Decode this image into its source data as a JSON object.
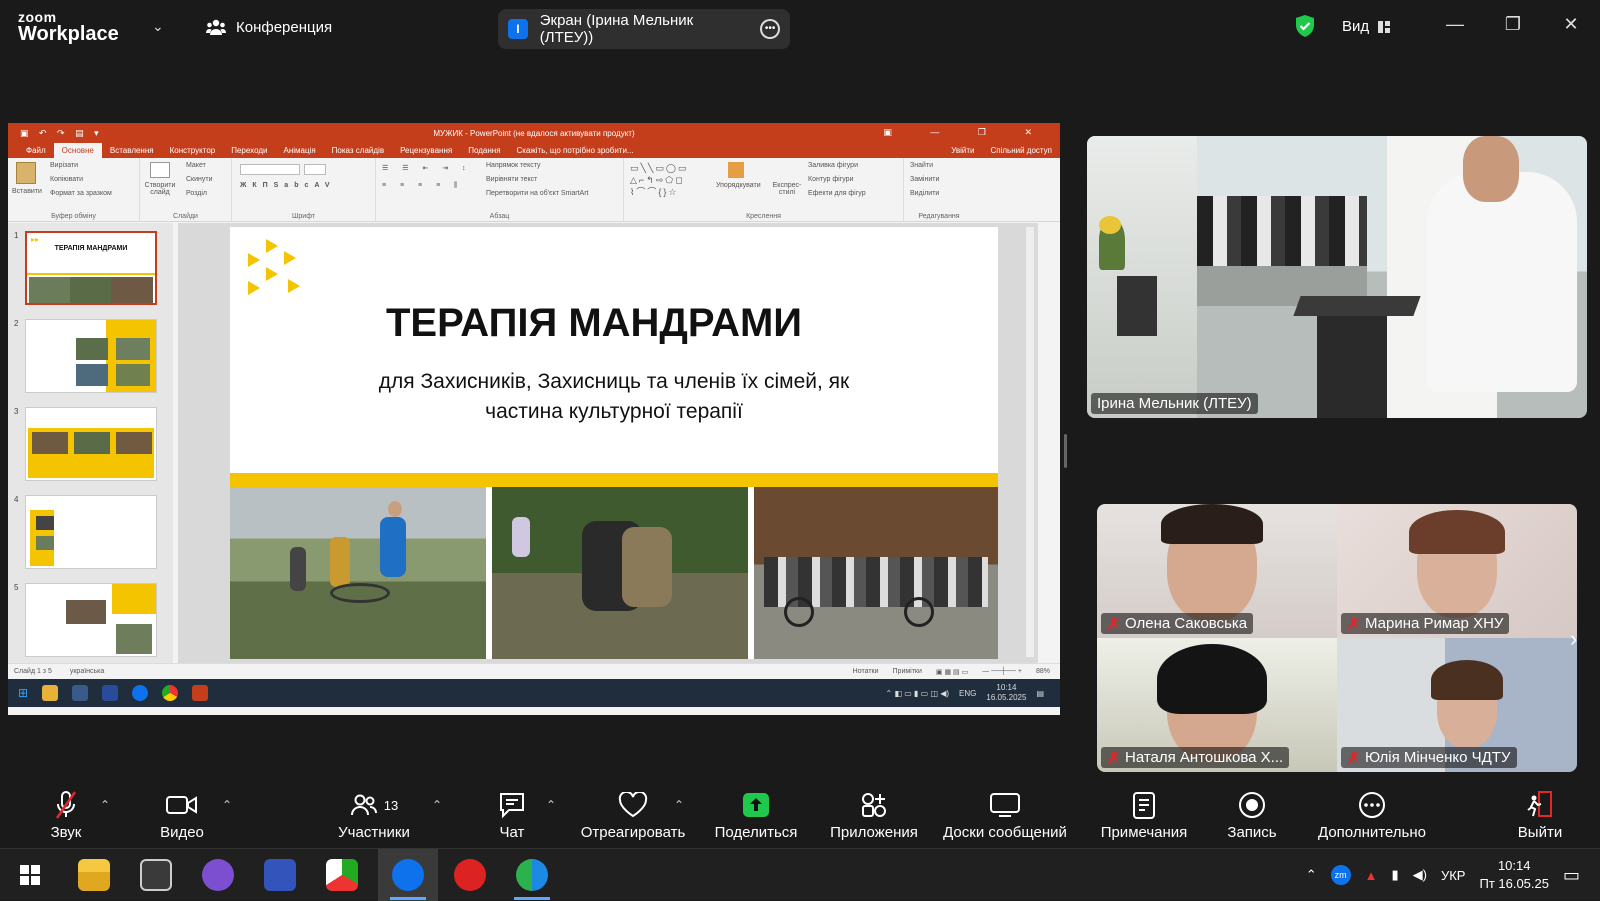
{
  "app": {
    "logo_line1": "zoom",
    "logo_line2": "Workplace",
    "conference_label": "Конференция",
    "screen_badge": "I",
    "screen_label": "Экран (Ірина Мельник  (ЛТЕУ))",
    "view_label": "Вид"
  },
  "powerpoint": {
    "title": "МУЖИК - PowerPoint (не вдалося активувати продукт)",
    "menu": [
      "Файл",
      "Основне",
      "Вставлення",
      "Конструктор",
      "Переходи",
      "Анімація",
      "Показ слайдів",
      "Рецензування",
      "Подання",
      "Скажіть, що потрібно зробити..."
    ],
    "menu_right": [
      "Увійти",
      "Спільний доступ"
    ],
    "ribbon": {
      "paste": "Вставити",
      "cut": "Вирізати",
      "copy": "Копіювати",
      "format_painter": "Формат за зразком",
      "clipboard": "Буфер обміну",
      "new_slide": "Створити слайд",
      "layout": "Макет",
      "reset": "Скинути",
      "section": "Розділ",
      "slides": "Слайди",
      "font": "Шрифт",
      "text_direction": "Напрямок тексту",
      "align_text": "Вирівняти текст",
      "smartart": "Перетворити на об'єкт SmartArt",
      "paragraph": "Абзац",
      "arrange": "Упорядкувати",
      "quick_styles": "Експрес-стилі",
      "shape_fill": "Заливка фігури",
      "shape_outline": "Контур фігури",
      "shape_effects": "Ефекти для фігур",
      "drawing": "Креслення",
      "find": "Знайти",
      "replace": "Замінити",
      "select": "Виділити",
      "editing": "Редагування"
    },
    "slide_numbers": [
      "1",
      "2",
      "3",
      "4",
      "5"
    ],
    "thumb1_title": "ТЕРАПІЯ МАНДРАМИ",
    "slide": {
      "title": "ТЕРАПІЯ МАНДРАМИ",
      "subtitle": "для Захисників, Захисниць та членів їх сімей, як частина культурної терапії"
    },
    "status": {
      "slide_count": "Слайд 1 з 5",
      "language": "українська",
      "notes": "Нотатки",
      "comments": "Примітки",
      "zoom": "88%"
    },
    "inner_taskbar": {
      "lang": "ENG",
      "time": "10:14",
      "date": "16.05.2025"
    }
  },
  "participants": {
    "speaker": "Ірина Мельник  (ЛТЕУ)",
    "grid": [
      {
        "name": "Олена Саковська"
      },
      {
        "name": "Марина Римар ХНУ"
      },
      {
        "name": "Наталя Антошкова Х..."
      },
      {
        "name": "Юлія Мінченко ЧДТУ"
      }
    ]
  },
  "toolbar": {
    "audio": "Звук",
    "video": "Видео",
    "participants": "Участники",
    "participants_count": "13",
    "chat": "Чат",
    "react": "Отреагировать",
    "share": "Поделиться",
    "apps": "Приложения",
    "boards": "Доски сообщений",
    "notes": "Примечания",
    "record": "Запись",
    "more": "Дополнительно",
    "leave": "Выйти"
  },
  "taskbar": {
    "lang": "УКР",
    "time": "10:14",
    "date": "Пт 16.05.25"
  },
  "colors": {
    "zoom_blue": "#0e72ed",
    "share_green": "#1ec94c",
    "ppt_orange": "#c43e1c",
    "slide_yellow": "#f5c400",
    "muted_red": "#e02828"
  }
}
